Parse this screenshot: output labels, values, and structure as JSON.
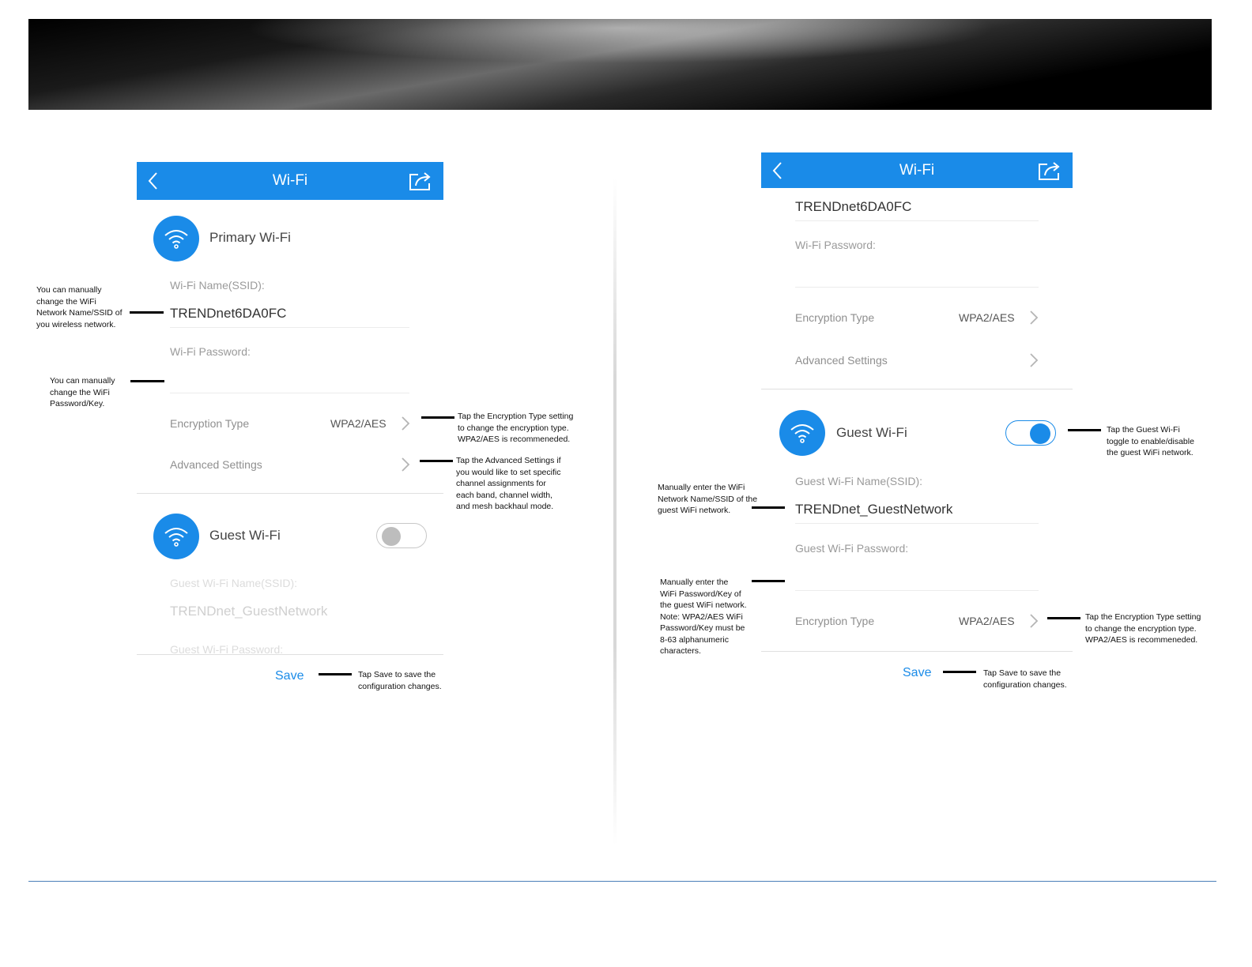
{
  "colors": {
    "accent": "#1a8be8",
    "pointer": "#000000"
  },
  "left_screen": {
    "appbar": {
      "title": "Wi-Fi",
      "back_icon": "chevron-left-icon",
      "share_icon": "share-icon"
    },
    "primary": {
      "title": "Primary Wi-Fi",
      "ssid_label": "Wi-Fi Name(SSID):",
      "ssid_value": "TRENDnet6DA0FC",
      "password_label": "Wi-Fi Password:",
      "encryption_label": "Encryption Type",
      "encryption_value": "WPA2/AES",
      "advanced_label": "Advanced Settings"
    },
    "guest": {
      "title": "Guest Wi-Fi",
      "toggle_state": "off",
      "ssid_label": "Guest Wi-Fi Name(SSID):",
      "ssid_value": "TRENDnet_GuestNetwork",
      "password_label": "Guest Wi-Fi Password:"
    },
    "save_label": "Save"
  },
  "right_screen": {
    "appbar": {
      "title": "Wi-Fi",
      "back_icon": "chevron-left-icon",
      "share_icon": "share-icon"
    },
    "primary": {
      "ssid_value": "TRENDnet6DA0FC",
      "password_label": "Wi-Fi Password:",
      "encryption_label": "Encryption Type",
      "encryption_value": "WPA2/AES",
      "advanced_label": "Advanced Settings"
    },
    "guest": {
      "title": "Guest Wi-Fi",
      "toggle_state": "on",
      "ssid_label": "Guest Wi-Fi Name(SSID):",
      "ssid_value": "TRENDnet_GuestNetwork",
      "password_label": "Guest Wi-Fi Password:",
      "encryption_label": "Encryption Type",
      "encryption_value": "WPA2/AES"
    },
    "save_label": "Save"
  },
  "annotations": {
    "left_ssid": "You can manually\nchange the WiFi\nNetwork Name/SSID of\nyou wireless network.",
    "left_password": "You can manually\nchange the WiFi\nPassword/Key.",
    "left_encryption": "Tap the Encryption Type setting\nto change the encryption type.\nWPA2/AES is recommeneded.",
    "left_advanced": "Tap the Advanced Settings if\nyou would like to set specific\nchannel assignments for\neach band, channel width,\nand mesh backhaul mode.",
    "left_save": "Tap Save to save the\nconfiguration changes.",
    "right_toggle": "Tap the Guest Wi-Fi\ntoggle to enable/disable\nthe guest WiFi network.",
    "right_guest_ssid": "Manually enter the WiFi\nNetwork Name/SSID of the\nguest WiFi network.",
    "right_guest_password": "Manually enter the\nWiFi Password/Key of\nthe guest WiFi network.\nNote: WPA2/AES WiFi\nPassword/Key must be\n8-63 alphanumeric\ncharacters.",
    "right_encryption": "Tap the Encryption Type setting\nto change the encryption type.\nWPA2/AES is recommeneded.",
    "right_save": "Tap Save to save the\nconfiguration changes."
  }
}
